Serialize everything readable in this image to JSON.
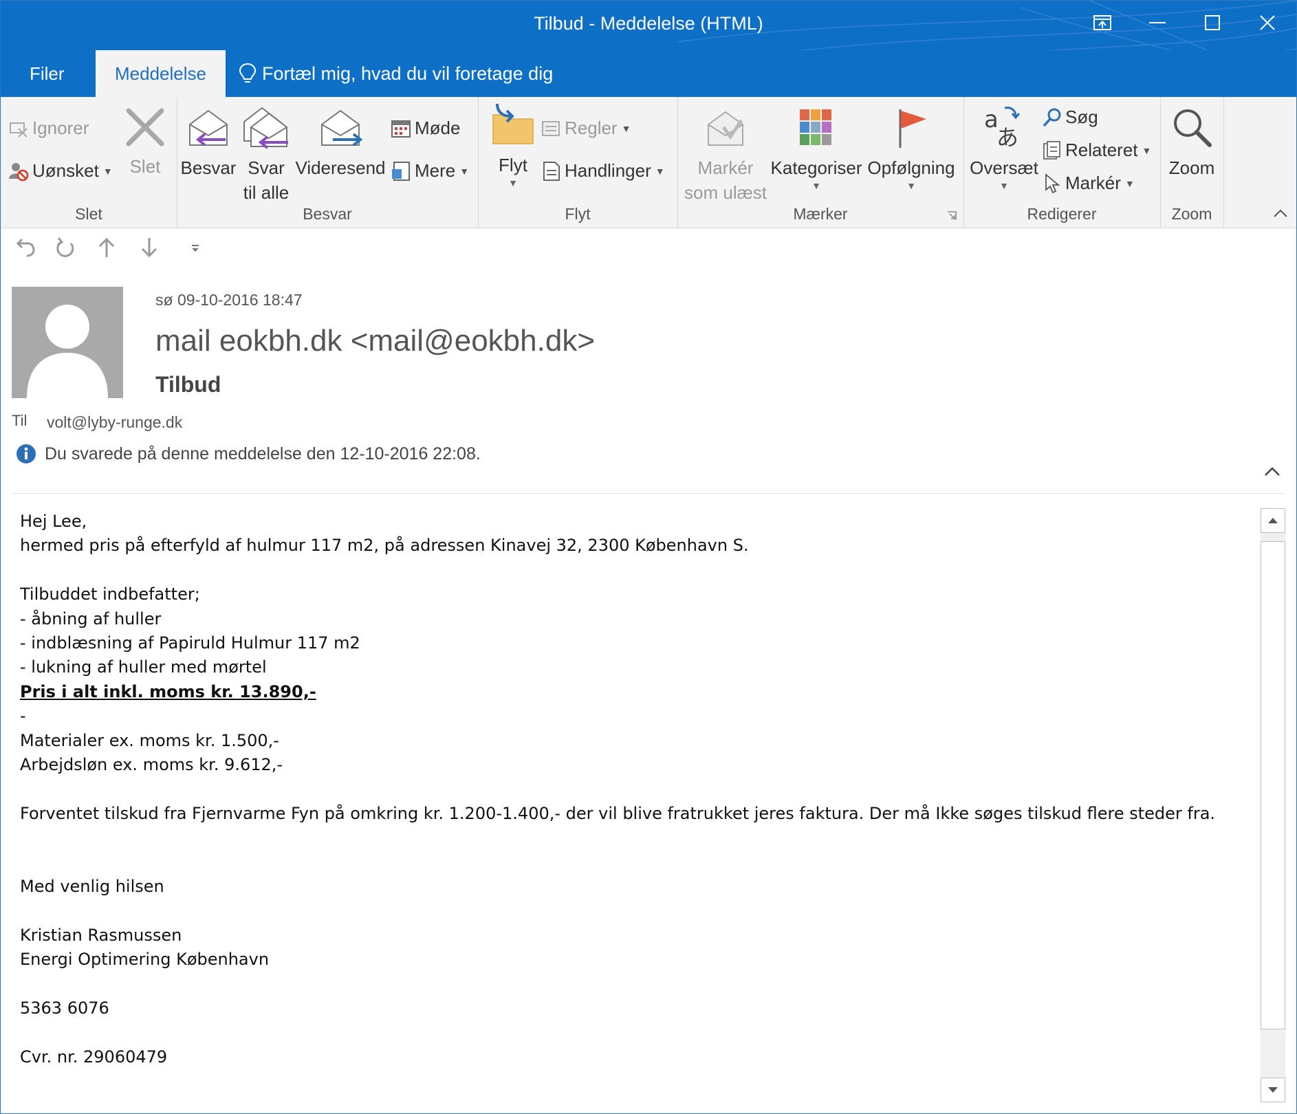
{
  "window": {
    "title": "Tilbud  -  Meddelelse (HTML)"
  },
  "tabs": {
    "file": "Filer",
    "message": "Meddelelse",
    "tell_me": "Fortæl mig, hvad du vil foretage dig"
  },
  "ribbon": {
    "delete_group": {
      "label": "Slet",
      "ignore": "Ignorer",
      "junk": "Uønsket",
      "delete": "Slet"
    },
    "respond_group": {
      "label": "Besvar",
      "reply": "Besvar",
      "reply_all_line1": "Svar",
      "reply_all_line2": "til alle",
      "forward": "Videresend",
      "meeting": "Møde",
      "more": "Mere"
    },
    "move_group": {
      "label": "Flyt",
      "move": "Flyt",
      "rules": "Regler",
      "actions": "Handlinger"
    },
    "tags_group": {
      "label": "Mærker",
      "mark_unread_line1": "Markér",
      "mark_unread_line2": "som ulæst",
      "categorize": "Kategoriser",
      "follow_up": "Opfølgning"
    },
    "editing_group": {
      "label": "Redigerer",
      "translate": "Oversæt",
      "find": "Søg",
      "related": "Relateret",
      "select": "Markér"
    },
    "zoom_group": {
      "label": "Zoom",
      "zoom": "Zoom"
    }
  },
  "header": {
    "date": "sø 09-10-2016 18:47",
    "from": "mail eokbh.dk <mail@eokbh.dk>",
    "subject": "Tilbud",
    "to_label": "Til",
    "to_value": "volt@lyby-runge.dk",
    "info": "Du svarede på denne meddelelse den 12-10-2016 22:08."
  },
  "body": {
    "lines": [
      "Hej Lee,",
      "hermed pris på efterfyld af hulmur 117 m2, på adressen Kinavej 32, 2300 København S.",
      "",
      "Tilbuddet indbefatter;",
      "- åbning af huller",
      "- indblæsning af Papiruld Hulmur 117 m2",
      "- lukning af huller med mørtel",
      "Pris i alt inkl. moms kr. 13.890,-",
      "-",
      "Materialer ex. moms kr. 1.500,-",
      "Arbejdsløn ex. moms kr. 9.612,-",
      "",
      "Forventet tilskud fra Fjernvarme Fyn på omkring kr. 1.200-1.400,- der vil blive fratrukket jeres faktura. Der må Ikke søges tilskud flere steder fra.",
      "",
      "",
      "Med venlig hilsen",
      "",
      "Kristian Rasmussen",
      "Energi Optimering København",
      "",
      "5363 6076",
      "",
      "Cvr. nr. 29060479"
    ]
  },
  "colors": {
    "titlebar": "#0e6fc6",
    "ribbon_bg": "#f3f3f3",
    "active_tab_text": "#1f6fbf",
    "info_icon": "#2b6fb6",
    "flag": "#e35a3c"
  }
}
